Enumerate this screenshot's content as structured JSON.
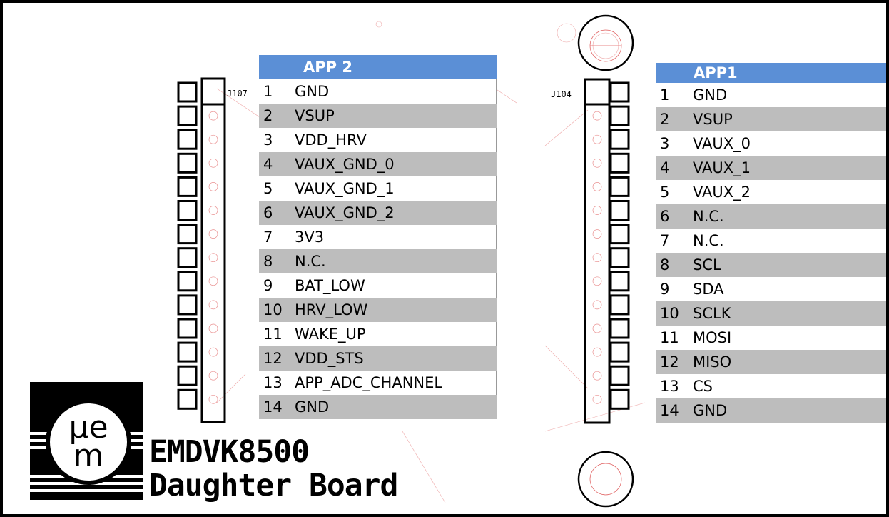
{
  "app2": {
    "title": "APP 2",
    "connector": "J107",
    "pins": [
      {
        "num": "1",
        "signal": "GND"
      },
      {
        "num": "2",
        "signal": "VSUP"
      },
      {
        "num": "3",
        "signal": "VDD_HRV"
      },
      {
        "num": "4",
        "signal": "VAUX_GND_0"
      },
      {
        "num": "5",
        "signal": "VAUX_GND_1"
      },
      {
        "num": "6",
        "signal": "VAUX_GND_2"
      },
      {
        "num": "7",
        "signal": "3V3"
      },
      {
        "num": "8",
        "signal": "N.C."
      },
      {
        "num": "9",
        "signal": "BAT_LOW"
      },
      {
        "num": "10",
        "signal": "HRV_LOW"
      },
      {
        "num": "11",
        "signal": "WAKE_UP"
      },
      {
        "num": "12",
        "signal": "VDD_STS"
      },
      {
        "num": "13",
        "signal": "APP_ADC_CHANNEL"
      },
      {
        "num": "14",
        "signal": "GND"
      }
    ]
  },
  "app1": {
    "title": "APP1",
    "connector": "J104",
    "pins": [
      {
        "num": "1",
        "signal": "GND"
      },
      {
        "num": "2",
        "signal": "VSUP"
      },
      {
        "num": "3",
        "signal": "VAUX_0"
      },
      {
        "num": "4",
        "signal": "VAUX_1"
      },
      {
        "num": "5",
        "signal": "VAUX_2"
      },
      {
        "num": "6",
        "signal": "N.C."
      },
      {
        "num": "7",
        "signal": "N.C."
      },
      {
        "num": "8",
        "signal": "SCL"
      },
      {
        "num": "9",
        "signal": "SDA"
      },
      {
        "num": "10",
        "signal": "SCLK"
      },
      {
        "num": "11",
        "signal": "MOSI"
      },
      {
        "num": "12",
        "signal": "MISO"
      },
      {
        "num": "13",
        "signal": "CS"
      },
      {
        "num": "14",
        "signal": "GND"
      }
    ]
  },
  "branding": {
    "logo_top": "µe",
    "logo_bottom": "m",
    "line1": "EMDVK8500",
    "line2": "Daughter Board"
  },
  "colors": {
    "header_blue": "#5b8fd6",
    "row_gray": "#bdbdbd",
    "silkscreen_red": "#e06060"
  }
}
